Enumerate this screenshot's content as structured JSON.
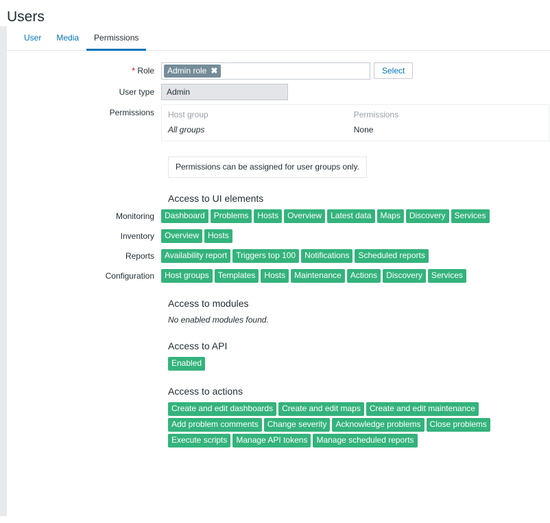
{
  "page": {
    "title": "Users"
  },
  "tabs": [
    {
      "label": "User",
      "active": false
    },
    {
      "label": "Media",
      "active": false
    },
    {
      "label": "Permissions",
      "active": true
    }
  ],
  "form": {
    "role": {
      "label": "Role",
      "required_mark": "*",
      "chip": "Admin role",
      "chip_remove_icon": "close-icon",
      "select_button": "Select"
    },
    "user_type": {
      "label": "User type",
      "value": "Admin"
    },
    "permissions": {
      "label": "Permissions",
      "columns": [
        "Host group",
        "Permissions"
      ],
      "rows": [
        {
          "host_group": "All groups",
          "permission": "None"
        }
      ]
    },
    "notice": "Permissions can be assigned for user groups only."
  },
  "ui_elements": {
    "title": "Access to UI elements",
    "groups": [
      {
        "label": "Monitoring",
        "items": [
          "Dashboard",
          "Problems",
          "Hosts",
          "Overview",
          "Latest data",
          "Maps",
          "Discovery",
          "Services"
        ]
      },
      {
        "label": "Inventory",
        "items": [
          "Overview",
          "Hosts"
        ]
      },
      {
        "label": "Reports",
        "items": [
          "Availability report",
          "Triggers top 100",
          "Notifications",
          "Scheduled reports"
        ]
      },
      {
        "label": "Configuration",
        "items": [
          "Host groups",
          "Templates",
          "Hosts",
          "Maintenance",
          "Actions",
          "Discovery",
          "Services"
        ]
      }
    ]
  },
  "modules": {
    "title": "Access to modules",
    "empty_text": "No enabled modules found."
  },
  "api": {
    "title": "Access to API",
    "status": "Enabled"
  },
  "actions": {
    "title": "Access to actions",
    "items": [
      "Create and edit dashboards",
      "Create and edit maps",
      "Create and edit maintenance",
      "Add problem comments",
      "Change severity",
      "Acknowledge problems",
      "Close problems",
      "Execute scripts",
      "Manage API tokens",
      "Manage scheduled reports"
    ]
  },
  "colors": {
    "accent": "#0275b8",
    "badge_green": "#34b37c",
    "chip_gray": "#768d99",
    "band": "#e8ebee",
    "required": "#d40000"
  }
}
